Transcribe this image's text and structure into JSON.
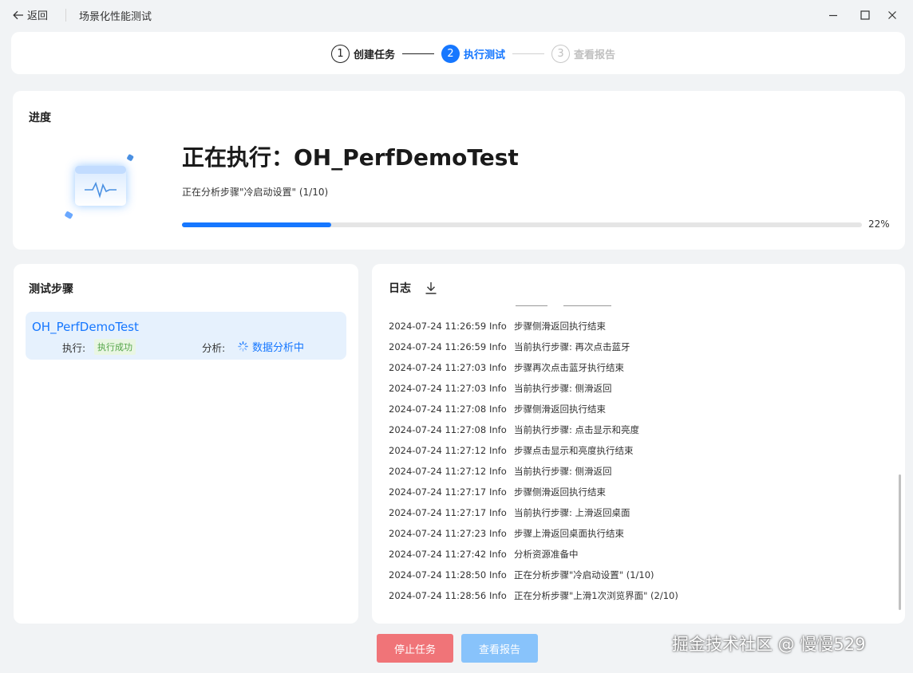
{
  "header": {
    "back_label": "返回",
    "title": "场景化性能测试"
  },
  "stepper": {
    "steps": [
      {
        "number": "1",
        "label": "创建任务",
        "state": "done"
      },
      {
        "number": "2",
        "label": "执行测试",
        "state": "active"
      },
      {
        "number": "3",
        "label": "查看报告",
        "state": "todo"
      }
    ]
  },
  "progress": {
    "section_title": "进度",
    "running_title": "正在执行：OH_PerfDemoTest",
    "status_text": "正在分析步骤\"冷启动设置\" (1/10)",
    "percent": 22,
    "percent_label": "22%"
  },
  "test_steps": {
    "section_title": "测试步骤",
    "items": [
      {
        "name": "OH_PerfDemoTest",
        "exec_label": "执行:",
        "exec_status": "执行成功",
        "analysis_label": "分析:",
        "analysis_status": "数据分析中"
      }
    ]
  },
  "log": {
    "section_title": "日志",
    "entries": [
      {
        "time": "2024-07-24 11:26:59",
        "level": "Info",
        "message": "步骤侧滑返回执行结束"
      },
      {
        "time": "2024-07-24 11:26:59",
        "level": "Info",
        "message": "当前执行步骤: 再次点击蓝牙"
      },
      {
        "time": "2024-07-24 11:27:03",
        "level": "Info",
        "message": "步骤再次点击蓝牙执行结束"
      },
      {
        "time": "2024-07-24 11:27:03",
        "level": "Info",
        "message": "当前执行步骤: 侧滑返回"
      },
      {
        "time": "2024-07-24 11:27:08",
        "level": "Info",
        "message": "步骤侧滑返回执行结束"
      },
      {
        "time": "2024-07-24 11:27:08",
        "level": "Info",
        "message": "当前执行步骤: 点击显示和亮度"
      },
      {
        "time": "2024-07-24 11:27:12",
        "level": "Info",
        "message": "步骤点击显示和亮度执行结束"
      },
      {
        "time": "2024-07-24 11:27:12",
        "level": "Info",
        "message": "当前执行步骤: 侧滑返回"
      },
      {
        "time": "2024-07-24 11:27:17",
        "level": "Info",
        "message": "步骤侧滑返回执行结束"
      },
      {
        "time": "2024-07-24 11:27:17",
        "level": "Info",
        "message": "当前执行步骤: 上滑返回桌面"
      },
      {
        "time": "2024-07-24 11:27:23",
        "level": "Info",
        "message": "步骤上滑返回桌面执行结束"
      },
      {
        "time": "2024-07-24 11:27:42",
        "level": "Info",
        "message": "分析资源准备中"
      },
      {
        "time": "2024-07-24 11:28:50",
        "level": "Info",
        "message": "正在分析步骤\"冷启动设置\" (1/10)"
      },
      {
        "time": "2024-07-24 11:28:56",
        "level": "Info",
        "message": "正在分析步骤\"上滑1次浏览界面\" (2/10)"
      }
    ]
  },
  "buttons": {
    "stop_label": "停止任务",
    "report_label": "查看报告"
  },
  "watermark": "掘金技术社区 @ 慢慢529",
  "colors": {
    "accent": "#1677ff",
    "success_text": "#52a447",
    "stop_button": "#f07478",
    "report_button_disabled": "#88c3fb",
    "page_background": "#f1f3f5"
  }
}
